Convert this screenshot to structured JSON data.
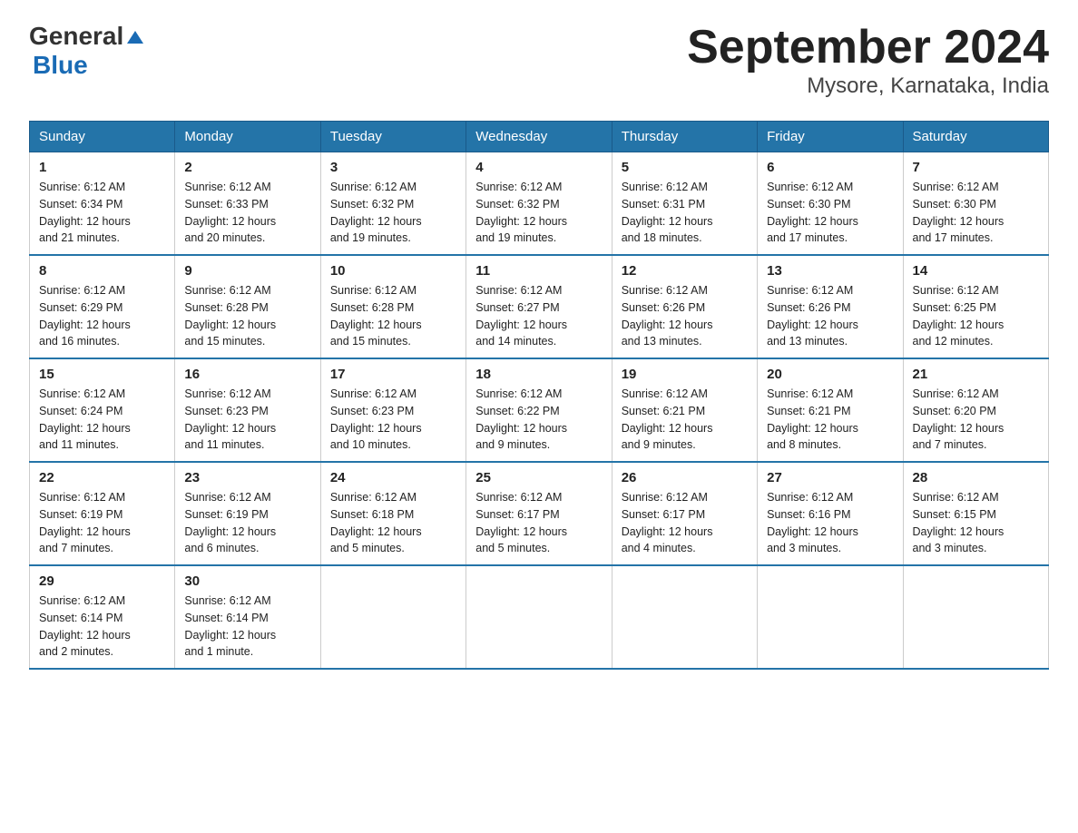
{
  "header": {
    "logo_general": "General",
    "logo_blue": "Blue",
    "title": "September 2024",
    "subtitle": "Mysore, Karnataka, India"
  },
  "calendar": {
    "headers": [
      "Sunday",
      "Monday",
      "Tuesday",
      "Wednesday",
      "Thursday",
      "Friday",
      "Saturday"
    ],
    "weeks": [
      [
        {
          "day": "1",
          "sunrise": "6:12 AM",
          "sunset": "6:34 PM",
          "daylight": "12 hours and 21 minutes."
        },
        {
          "day": "2",
          "sunrise": "6:12 AM",
          "sunset": "6:33 PM",
          "daylight": "12 hours and 20 minutes."
        },
        {
          "day": "3",
          "sunrise": "6:12 AM",
          "sunset": "6:32 PM",
          "daylight": "12 hours and 19 minutes."
        },
        {
          "day": "4",
          "sunrise": "6:12 AM",
          "sunset": "6:32 PM",
          "daylight": "12 hours and 19 minutes."
        },
        {
          "day": "5",
          "sunrise": "6:12 AM",
          "sunset": "6:31 PM",
          "daylight": "12 hours and 18 minutes."
        },
        {
          "day": "6",
          "sunrise": "6:12 AM",
          "sunset": "6:30 PM",
          "daylight": "12 hours and 17 minutes."
        },
        {
          "day": "7",
          "sunrise": "6:12 AM",
          "sunset": "6:30 PM",
          "daylight": "12 hours and 17 minutes."
        }
      ],
      [
        {
          "day": "8",
          "sunrise": "6:12 AM",
          "sunset": "6:29 PM",
          "daylight": "12 hours and 16 minutes."
        },
        {
          "day": "9",
          "sunrise": "6:12 AM",
          "sunset": "6:28 PM",
          "daylight": "12 hours and 15 minutes."
        },
        {
          "day": "10",
          "sunrise": "6:12 AM",
          "sunset": "6:28 PM",
          "daylight": "12 hours and 15 minutes."
        },
        {
          "day": "11",
          "sunrise": "6:12 AM",
          "sunset": "6:27 PM",
          "daylight": "12 hours and 14 minutes."
        },
        {
          "day": "12",
          "sunrise": "6:12 AM",
          "sunset": "6:26 PM",
          "daylight": "12 hours and 13 minutes."
        },
        {
          "day": "13",
          "sunrise": "6:12 AM",
          "sunset": "6:26 PM",
          "daylight": "12 hours and 13 minutes."
        },
        {
          "day": "14",
          "sunrise": "6:12 AM",
          "sunset": "6:25 PM",
          "daylight": "12 hours and 12 minutes."
        }
      ],
      [
        {
          "day": "15",
          "sunrise": "6:12 AM",
          "sunset": "6:24 PM",
          "daylight": "12 hours and 11 minutes."
        },
        {
          "day": "16",
          "sunrise": "6:12 AM",
          "sunset": "6:23 PM",
          "daylight": "12 hours and 11 minutes."
        },
        {
          "day": "17",
          "sunrise": "6:12 AM",
          "sunset": "6:23 PM",
          "daylight": "12 hours and 10 minutes."
        },
        {
          "day": "18",
          "sunrise": "6:12 AM",
          "sunset": "6:22 PM",
          "daylight": "12 hours and 9 minutes."
        },
        {
          "day": "19",
          "sunrise": "6:12 AM",
          "sunset": "6:21 PM",
          "daylight": "12 hours and 9 minutes."
        },
        {
          "day": "20",
          "sunrise": "6:12 AM",
          "sunset": "6:21 PM",
          "daylight": "12 hours and 8 minutes."
        },
        {
          "day": "21",
          "sunrise": "6:12 AM",
          "sunset": "6:20 PM",
          "daylight": "12 hours and 7 minutes."
        }
      ],
      [
        {
          "day": "22",
          "sunrise": "6:12 AM",
          "sunset": "6:19 PM",
          "daylight": "12 hours and 7 minutes."
        },
        {
          "day": "23",
          "sunrise": "6:12 AM",
          "sunset": "6:19 PM",
          "daylight": "12 hours and 6 minutes."
        },
        {
          "day": "24",
          "sunrise": "6:12 AM",
          "sunset": "6:18 PM",
          "daylight": "12 hours and 5 minutes."
        },
        {
          "day": "25",
          "sunrise": "6:12 AM",
          "sunset": "6:17 PM",
          "daylight": "12 hours and 5 minutes."
        },
        {
          "day": "26",
          "sunrise": "6:12 AM",
          "sunset": "6:17 PM",
          "daylight": "12 hours and 4 minutes."
        },
        {
          "day": "27",
          "sunrise": "6:12 AM",
          "sunset": "6:16 PM",
          "daylight": "12 hours and 3 minutes."
        },
        {
          "day": "28",
          "sunrise": "6:12 AM",
          "sunset": "6:15 PM",
          "daylight": "12 hours and 3 minutes."
        }
      ],
      [
        {
          "day": "29",
          "sunrise": "6:12 AM",
          "sunset": "6:14 PM",
          "daylight": "12 hours and 2 minutes."
        },
        {
          "day": "30",
          "sunrise": "6:12 AM",
          "sunset": "6:14 PM",
          "daylight": "12 hours and 1 minute."
        },
        null,
        null,
        null,
        null,
        null
      ]
    ]
  }
}
